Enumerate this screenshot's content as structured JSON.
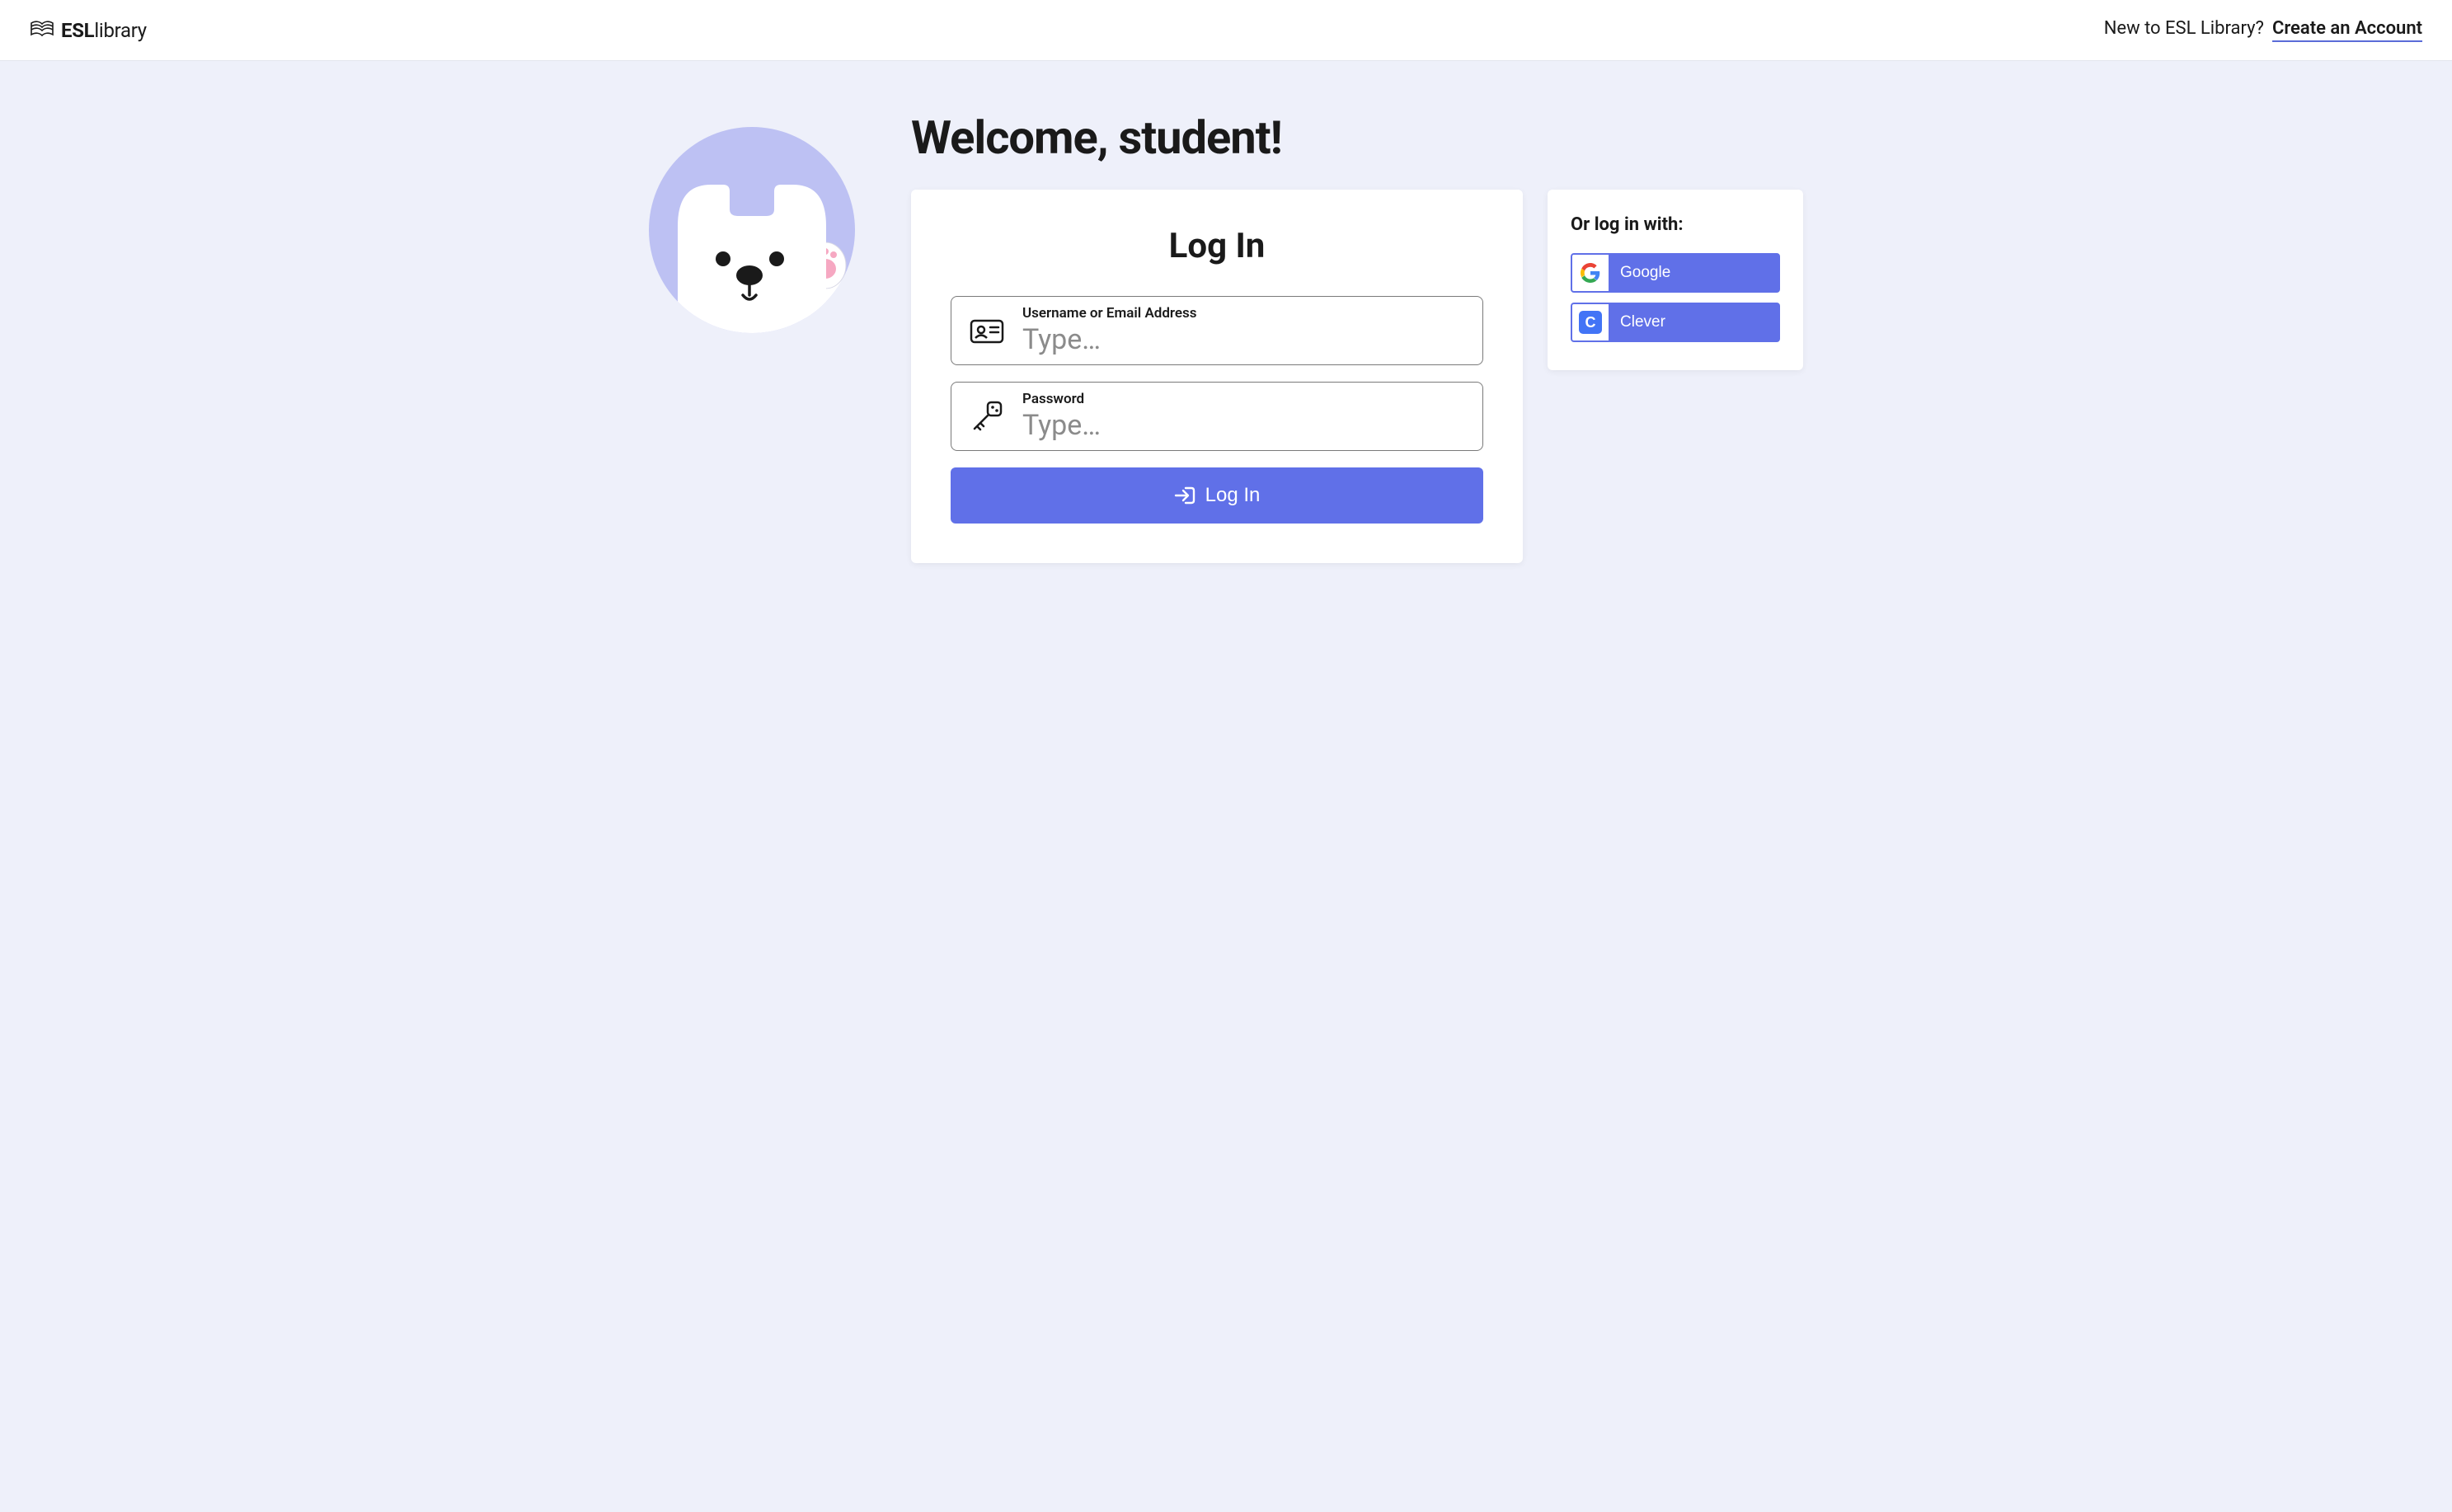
{
  "header": {
    "logo_bold": "ESL",
    "logo_light": "library",
    "prompt": "New to ESL Library?",
    "create_link": "Create an Account"
  },
  "welcome": "Welcome, student!",
  "login": {
    "title": "Log In",
    "username_label": "Username or Email Address",
    "username_placeholder": "Type…",
    "password_label": "Password",
    "password_placeholder": "Type…",
    "submit": "Log In"
  },
  "social": {
    "heading": "Or log in with:",
    "google": "Google",
    "clever": "Clever",
    "clever_badge": "C"
  },
  "colors": {
    "accent": "#6070e8",
    "page_bg": "#eef0fa",
    "mascot_bg": "#bdc1f3"
  }
}
